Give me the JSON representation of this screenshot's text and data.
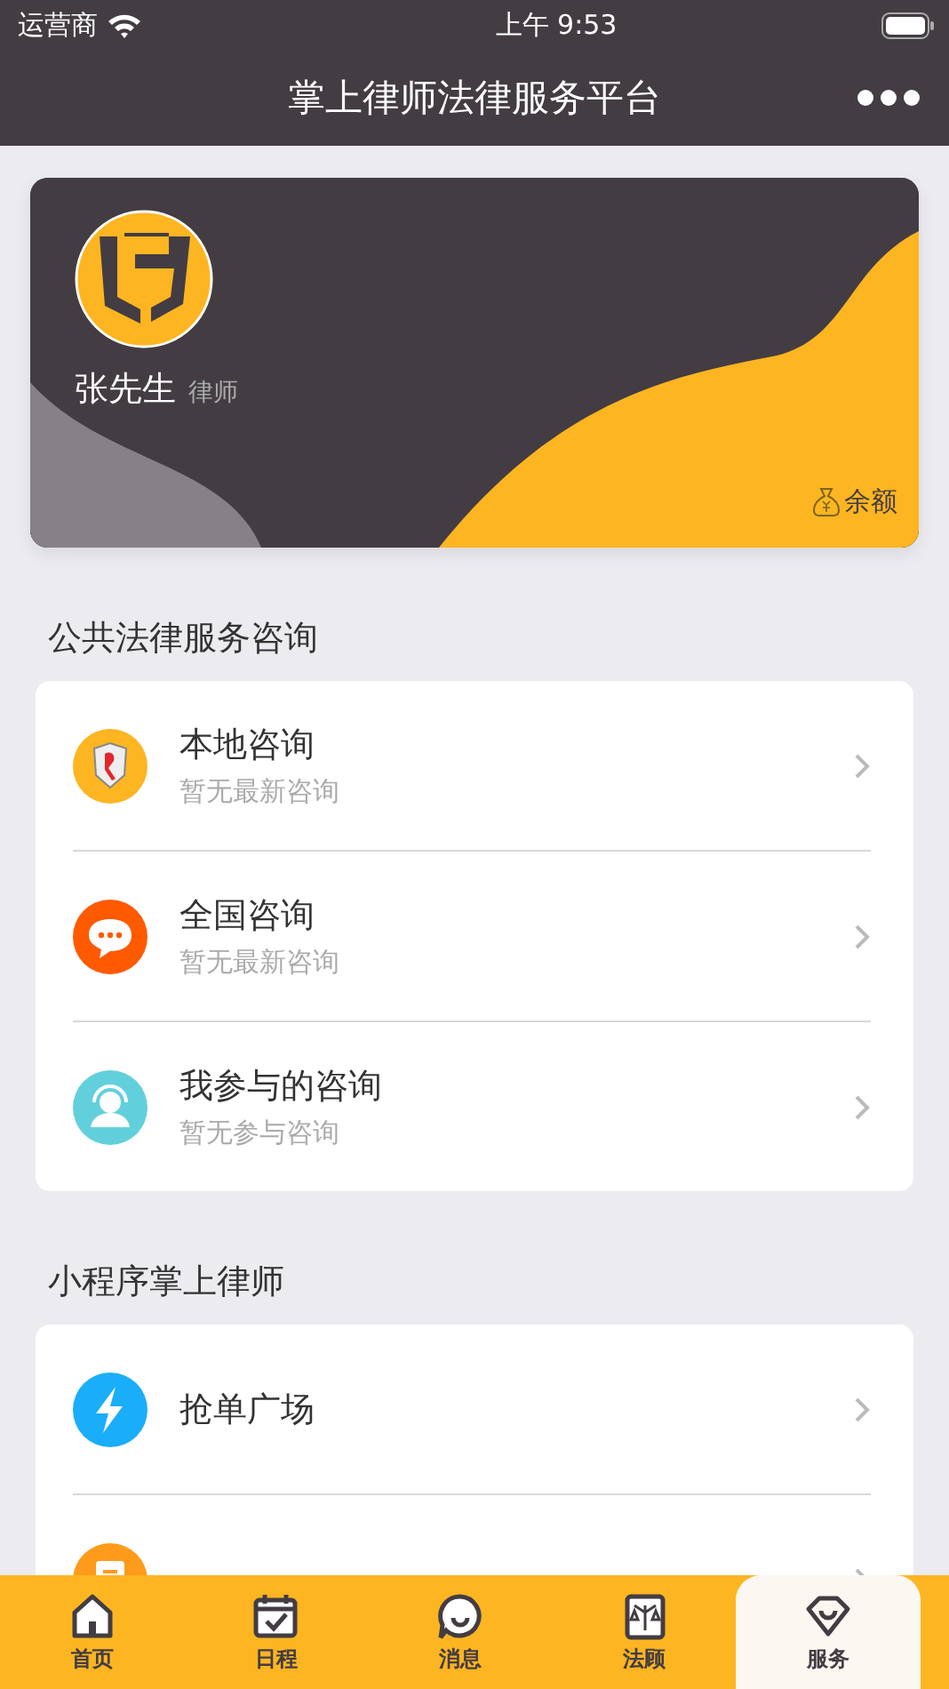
{
  "status_bar": {
    "carrier": "运营商",
    "time": "上午 9:53"
  },
  "nav": {
    "title": "掌上律师法律服务平台"
  },
  "profile": {
    "name": "张先生",
    "role": "律师",
    "balance_label": "余额"
  },
  "sections": [
    {
      "title": "公共法律服务咨询",
      "items": [
        {
          "kind": "shield",
          "title": "本地咨询",
          "subtitle": "暂无最新咨询"
        },
        {
          "kind": "chat",
          "title": "全国咨询",
          "subtitle": "暂无最新咨询"
        },
        {
          "kind": "headset",
          "title": "我参与的咨询",
          "subtitle": "暂无参与咨询"
        }
      ]
    },
    {
      "title": "小程序掌上律师",
      "items": [
        {
          "kind": "bolt",
          "title": "抢单广场"
        },
        {
          "kind": "clipboard"
        }
      ]
    }
  ],
  "tabs": [
    {
      "kind": "home",
      "label": "首页",
      "selected": false
    },
    {
      "kind": "calendar",
      "label": "日程",
      "selected": false
    },
    {
      "kind": "message",
      "label": "消息",
      "selected": false
    },
    {
      "kind": "scales",
      "label": "法顾",
      "selected": false
    },
    {
      "kind": "gem",
      "label": "服务",
      "selected": true
    }
  ]
}
